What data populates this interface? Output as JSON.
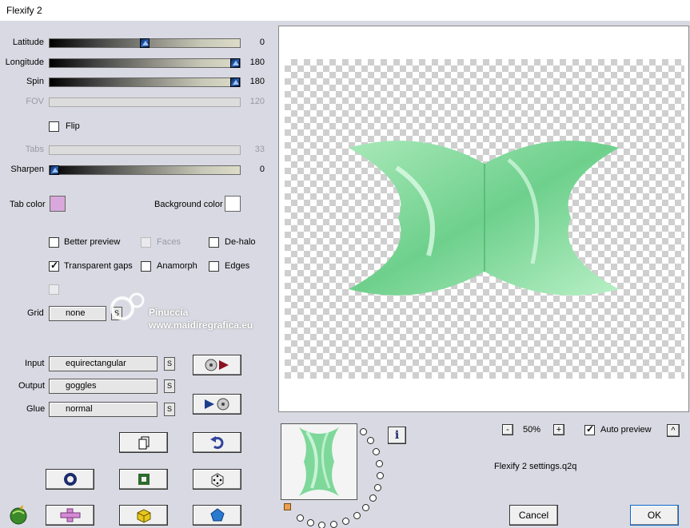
{
  "window": {
    "title": "Flexify 2"
  },
  "sliders": [
    {
      "label": "Latitude",
      "value": "0",
      "fraction": 0.5,
      "enabled": true
    },
    {
      "label": "Longitude",
      "value": "180",
      "fraction": 1.0,
      "enabled": true
    },
    {
      "label": "Spin",
      "value": "180",
      "fraction": 1.0,
      "enabled": true
    },
    {
      "label": "FOV",
      "value": "120",
      "fraction": 0.5,
      "enabled": false
    },
    {
      "label": "Tabs",
      "value": "33",
      "fraction": 0.33,
      "enabled": false
    },
    {
      "label": "Sharpen",
      "value": "0",
      "fraction": 0.0,
      "enabled": true
    }
  ],
  "flip": {
    "label": "Flip",
    "checked": false
  },
  "tab_color": {
    "label": "Tab color",
    "color": "#d8a8dc"
  },
  "background_color": {
    "label": "Background color",
    "color": "#ffffff"
  },
  "options": {
    "better_preview": {
      "label": "Better preview",
      "checked": false
    },
    "faces": {
      "label": "Faces",
      "checked": false,
      "enabled": false
    },
    "de_halo": {
      "label": "De-halo",
      "checked": false
    },
    "transparent_gaps": {
      "label": "Transparent gaps",
      "checked": true
    },
    "anamorph": {
      "label": "Anamorph",
      "checked": false
    },
    "edges": {
      "label": "Edges",
      "checked": false
    }
  },
  "grid": {
    "label": "Grid",
    "value": "none",
    "s": "S"
  },
  "watermark": {
    "name": "Pinuccia",
    "site": "www.maidiregrafica.eu"
  },
  "input": {
    "label": "Input",
    "value": "equirectangular",
    "s": "S"
  },
  "output": {
    "label": "Output",
    "value": "goggles",
    "s": "S"
  },
  "glue": {
    "label": "Glue",
    "value": "normal",
    "s": "S"
  },
  "zoom": {
    "minus": "-",
    "value": "50%",
    "plus": "+"
  },
  "auto_preview": {
    "label": "Auto preview",
    "checked": true,
    "toggle": "^"
  },
  "settings_file": "Flexify 2 settings.q2q",
  "buttons": {
    "cancel": "Cancel",
    "ok": "OK",
    "info": "i"
  }
}
